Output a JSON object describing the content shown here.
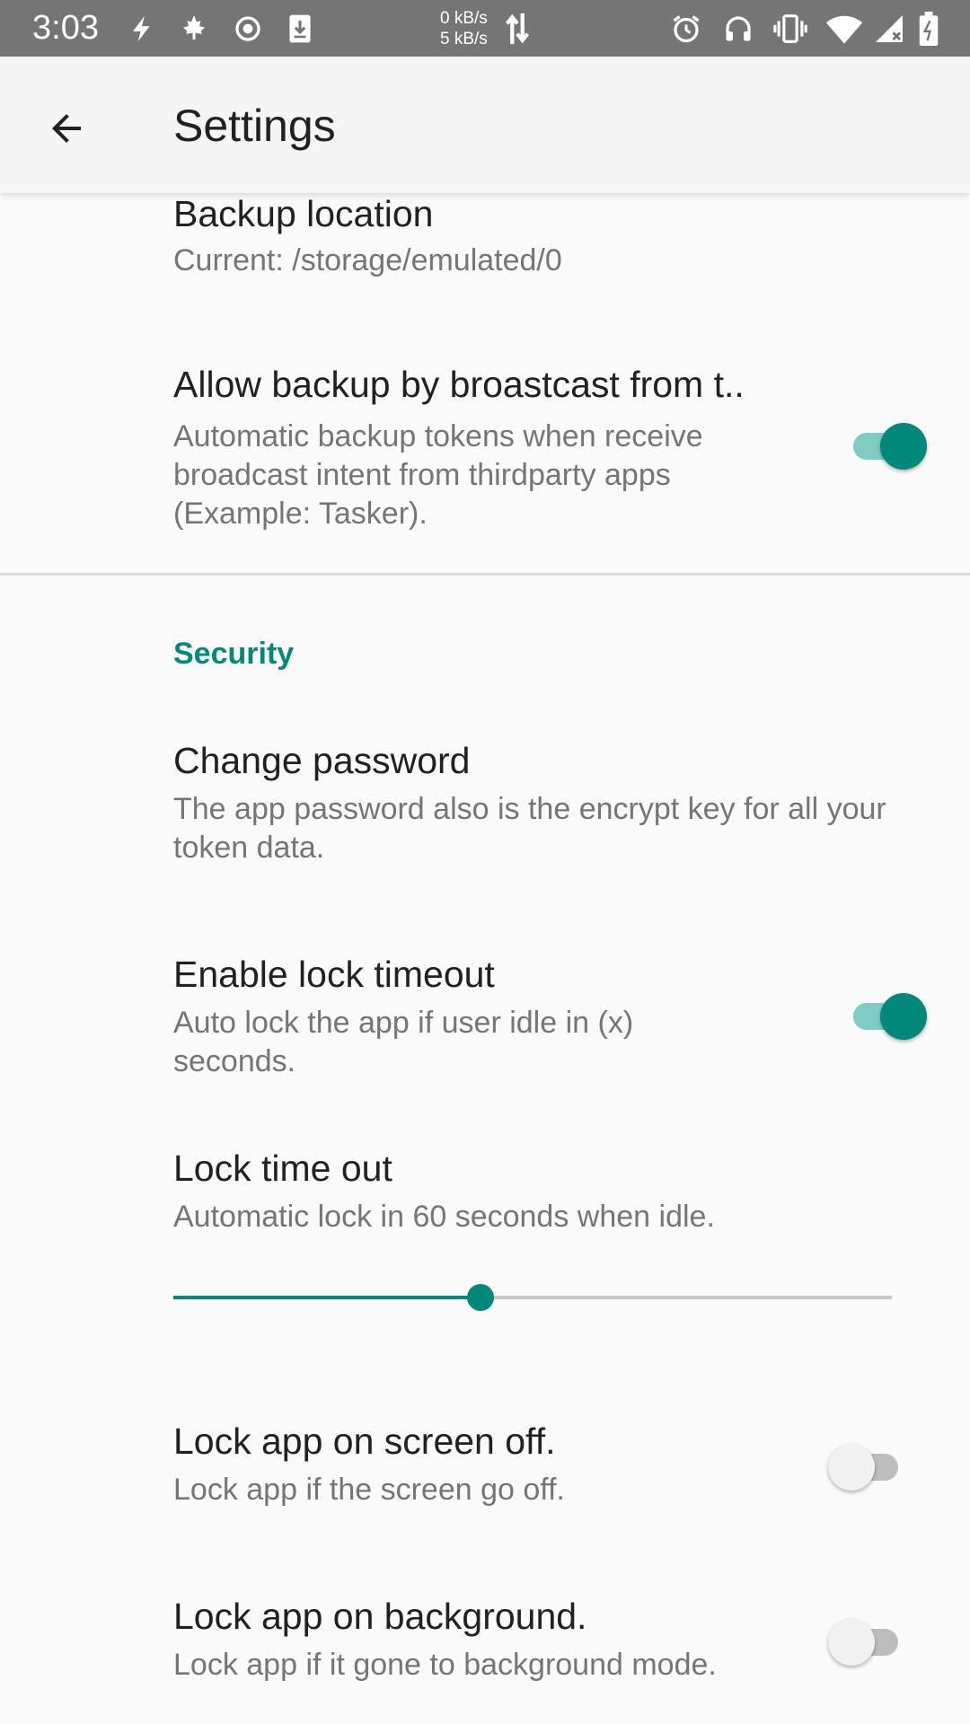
{
  "status_bar": {
    "time": "3:03",
    "speed_down": "0 kB/s",
    "speed_up": "5 kB/s",
    "icons_left": [
      "flash-icon",
      "maple-leaf-icon",
      "record-icon",
      "download-icon"
    ],
    "icons_right": [
      "alarm-icon",
      "headphones-icon",
      "vibrate-icon",
      "wifi-icon",
      "signal-icon",
      "battery-icon"
    ]
  },
  "app_bar": {
    "title": "Settings",
    "back_icon": "arrow-back-icon"
  },
  "prefs": {
    "backup_location": {
      "title": "Backup location",
      "summary": "Current: /storage/emulated/0"
    },
    "allow_broadcast_backup": {
      "title": "Allow backup by broastcast from t..",
      "summary": "Automatic backup tokens when receive broadcast intent from thirdparty apps (Example: Tasker).",
      "enabled": true
    },
    "security_category": "Security",
    "change_password": {
      "title": "Change password",
      "summary": "The app password also is the encrypt key for all your token data."
    },
    "enable_lock_timeout": {
      "title": "Enable lock timeout",
      "summary": "Auto lock the app if user idle in (x) seconds.",
      "enabled": true
    },
    "lock_time_out": {
      "title": "Lock time out",
      "summary": "Automatic lock in 60 seconds when idle.",
      "slider_fraction": 0.428
    },
    "lock_on_screen_off": {
      "title": "Lock app on screen off.",
      "summary": "Lock app if the screen go off.",
      "enabled": false
    },
    "lock_on_background": {
      "title": "Lock app on background.",
      "summary": "Lock app if it gone to background mode.",
      "enabled": false
    }
  },
  "colors": {
    "accent": "#00897b",
    "accent_light": "#80cbc4",
    "status_bar": "#757575",
    "app_bar": "#f5f5f5"
  }
}
